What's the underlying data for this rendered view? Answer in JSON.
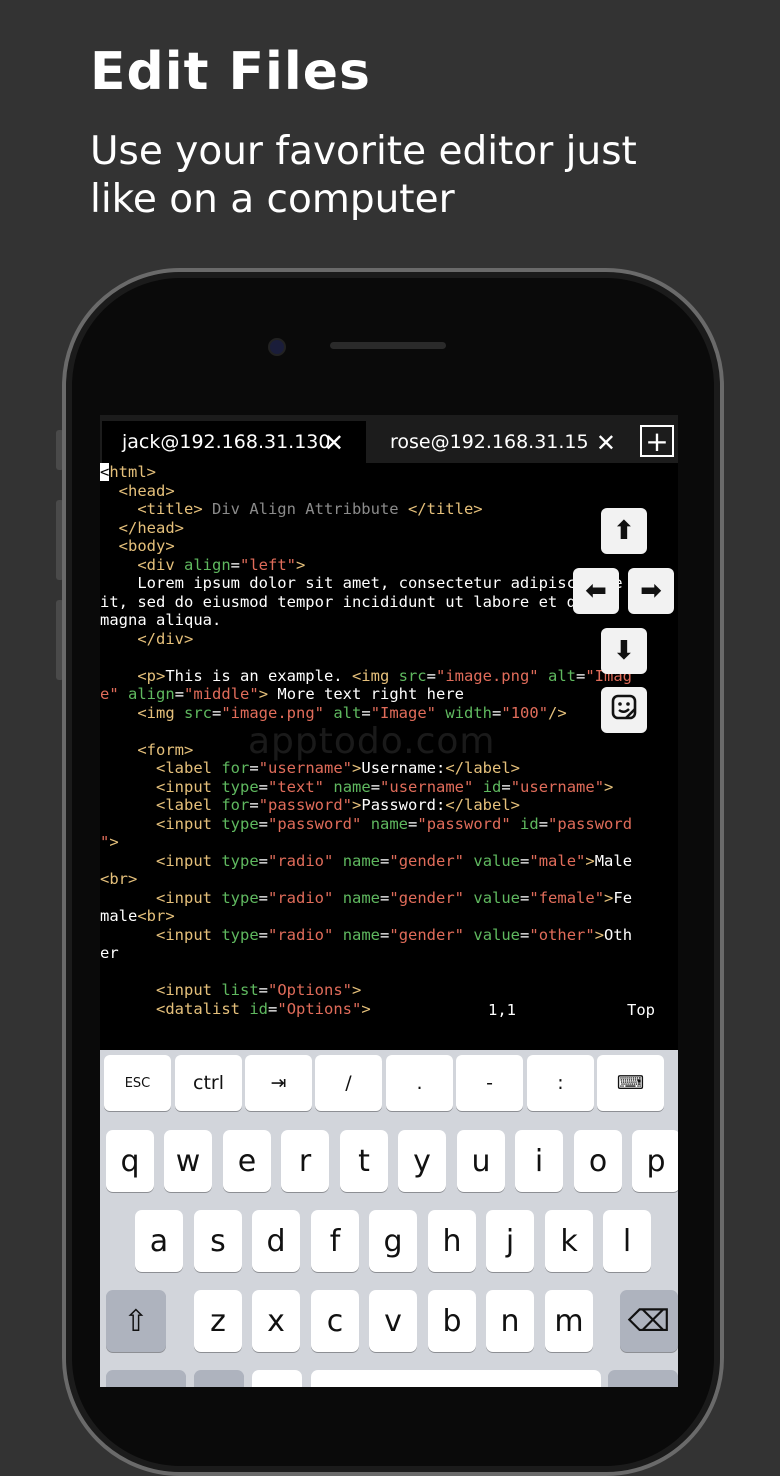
{
  "promo": {
    "title": "Edit Files",
    "subtitle": "Use your favorite editor just like on a computer"
  },
  "tabs": [
    {
      "label": "jack@192.168.31.130",
      "close": "✕"
    },
    {
      "label": "rose@192.168.31.15",
      "close": "✕"
    }
  ],
  "new_tab": "+",
  "editor": {
    "status_position": "1,1",
    "status_scroll": "Top"
  },
  "watermark": "apptodo.com",
  "arrow_keys": {
    "up": "⬆",
    "left": "⬅",
    "right": "➡",
    "down": "⬇",
    "snippet": "snippet-icon"
  },
  "accessory_keys": [
    "ESC",
    "ctrl",
    "⇥",
    "/",
    ".",
    "-",
    ":",
    "⌨"
  ],
  "keyboard": {
    "row1": [
      "q",
      "w",
      "e",
      "r",
      "t",
      "y",
      "u",
      "i",
      "o",
      "p"
    ],
    "row2": [
      "a",
      "s",
      "d",
      "f",
      "g",
      "h",
      "j",
      "k",
      "l"
    ],
    "row3": [
      "z",
      "x",
      "c",
      "v",
      "b",
      "n",
      "m"
    ],
    "shift": "⇧",
    "delete": "⌫"
  },
  "colors": {
    "tag": "#e5c07b",
    "attr": "#5fb85f",
    "string": "#e06c5a",
    "comment": "#8b8b8b"
  }
}
